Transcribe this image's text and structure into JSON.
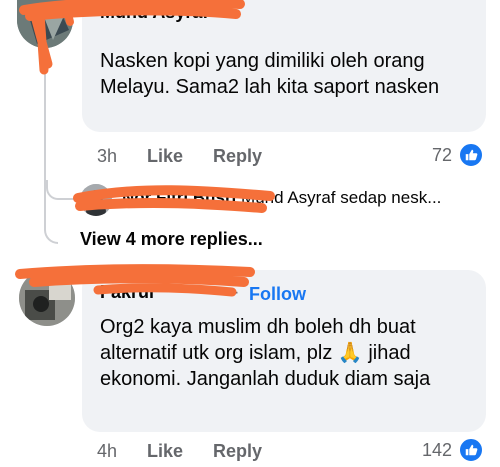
{
  "comments": [
    {
      "author": "Muhd Asyraf",
      "text": "Nasken kopi yang dimiliki oleh orang Melayu. Sama2 lah kita saport nasken",
      "time": "3h",
      "like_label": "Like",
      "reply_label": "Reply",
      "reaction_count": "72"
    },
    {
      "author": "Fakrul",
      "follow_label": "Follow",
      "text": "Org2 kaya muslim dh boleh dh buat alternatif utk org islam, plz 🙏 jihad ekonomi. Janganlah duduk diam saja",
      "time": "4h",
      "like_label": "Like",
      "reply_label": "Reply",
      "reaction_count": "142"
    }
  ],
  "reply": {
    "author": "Nor Fitri Busri",
    "mention": "Muhd Asyraf",
    "preview": "sedap nesk..."
  },
  "view_more_label": "View 4 more replies...",
  "colors": {
    "accent": "#1877f2",
    "redaction": "#f5703a",
    "bubble": "#f0f2f5"
  }
}
